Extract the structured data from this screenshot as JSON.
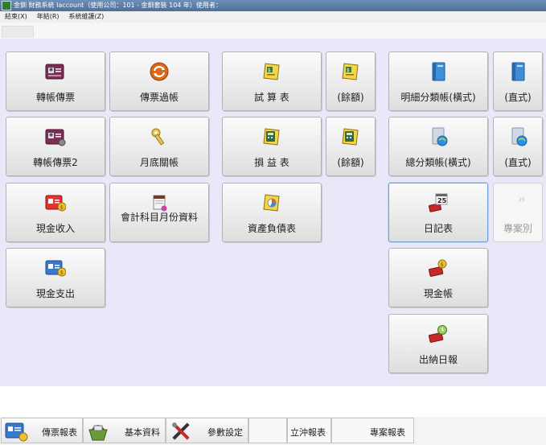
{
  "window": {
    "title": "金釧 財務系統 Iaccount（使用公司：101 - 金釧套裝 104 年）使用者："
  },
  "menu": [
    "結束(X)",
    "年結(R)",
    "系統維護(Z)"
  ],
  "buttons": {
    "transfer_voucher": "轉帳傳票",
    "voucher_posting": "傳票過帳",
    "trial_balance": "試 算 表",
    "trial_balance_amount": "(餘額)",
    "ledger_detail_horizontal": "明細分類帳(橫式)",
    "ledger_detail_vertical": "(直式)",
    "transfer_voucher_2": "轉帳傳票2",
    "month_end_close": "月底關帳",
    "income_statement": "損 益 表",
    "income_statement_amount": "(餘額)",
    "general_ledger_horizontal": "總分類帳(橫式)",
    "general_ledger_vertical": "(直式)",
    "cash_receipt": "現金收入",
    "account_monthly_data": "會計科目月份資料",
    "balance_sheet": "資產負債表",
    "journal": "日記表",
    "project": "專案別",
    "cash_payment": "現金支出",
    "cash_book": "現金帳",
    "cashier_daily": "出納日報"
  },
  "taskbar": {
    "voucher_reports": "傳票報表",
    "basic_data": "基本資料",
    "param_settings": "參數設定",
    "blank": "",
    "offset_reports": "立沖報表",
    "project_reports": "專案報表"
  },
  "icons": {
    "card_icon": "id-card-icon",
    "sync_icon": "refresh-icon",
    "ledger_icon": "ledger-book-icon",
    "calculator_icon": "calculator-icon",
    "blue_book_icon": "blue-book-icon",
    "key_icon": "key-icon",
    "calendar_icon": "calendar-icon",
    "money_card_icon": "money-card-icon",
    "red_book_icon": "red-book-icon"
  },
  "colors": {
    "panel_bg": "#e9e8f8",
    "accent": "#6fa0d8"
  }
}
